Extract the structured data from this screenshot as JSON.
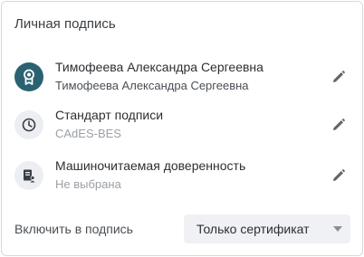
{
  "panel": {
    "title": "Личная подпись"
  },
  "rows": [
    {
      "primary": "Тимофеева Александра Сергеевна",
      "secondary": "Тимофеева Александра Сергеевна",
      "icon": "certificate-badge-icon"
    },
    {
      "primary": "Стандарт подписи",
      "secondary": "CAdES-BES",
      "icon": "clock-icon"
    },
    {
      "primary": "Машиночитаемая доверенность",
      "secondary": "Не выбрана",
      "icon": "power-of-attorney-icon"
    }
  ],
  "include": {
    "label": "Включить в подпись",
    "selected": "Только сертификат"
  },
  "colors": {
    "accent": "#2b6272",
    "icon_bg": "#eceef1",
    "select_bg": "#f0f1f4",
    "muted_text": "#9aa0a6"
  }
}
